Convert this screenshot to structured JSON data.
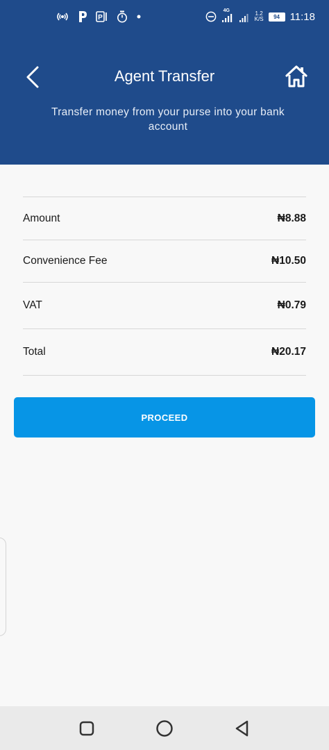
{
  "status_bar": {
    "time": "11:18",
    "battery": "94",
    "network_type": "4G",
    "net_speed_value": "1.2",
    "net_speed_unit": "K/S",
    "left_icons": [
      "hotspot-icon",
      "parking-p-icon",
      "parking-sign-icon",
      "timer-icon",
      "dot-icon"
    ],
    "right_icons": [
      "do-not-disturb-icon",
      "signal-4g-icon",
      "signal-icon",
      "battery-icon"
    ]
  },
  "header": {
    "title": "Agent Transfer",
    "subtitle": "Transfer money from your purse into your bank account",
    "background_color": "#1f4b8b",
    "back_icon": "chevron-left-icon",
    "home_icon": "home-icon"
  },
  "summary": {
    "rows": [
      {
        "label": "Amount",
        "value": "₦8.88"
      },
      {
        "label": "Convenience Fee",
        "value": "₦10.50"
      },
      {
        "label": "VAT",
        "value": "₦0.79"
      },
      {
        "label": "Total",
        "value": "₦20.17"
      }
    ]
  },
  "actions": {
    "proceed_label": "PROCEED",
    "proceed_color": "#0795e6"
  },
  "nav_bar": {
    "icons": [
      "recents-square-icon",
      "home-circle-icon",
      "back-triangle-icon"
    ]
  }
}
